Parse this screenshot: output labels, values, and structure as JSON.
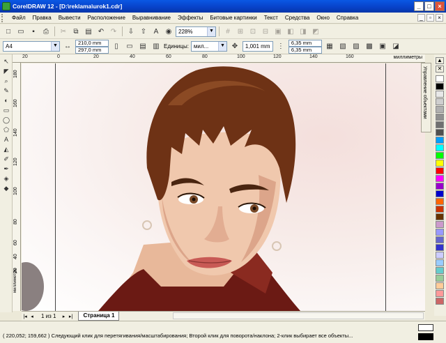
{
  "window": {
    "title": "CorelDRAW 12 - [D:\\reklama\\urok1.cdr]"
  },
  "menu": [
    {
      "label": "Файл"
    },
    {
      "label": "Правка"
    },
    {
      "label": "Вывести"
    },
    {
      "label": "Расположение"
    },
    {
      "label": "Выравнивание"
    },
    {
      "label": "Эффекты"
    },
    {
      "label": "Битовые картинки"
    },
    {
      "label": "Текст"
    },
    {
      "label": "Средства"
    },
    {
      "label": "Окно"
    },
    {
      "label": "Справка"
    }
  ],
  "toolbar": {
    "zoom": "228%"
  },
  "property_bar": {
    "paper": "A4",
    "width": "210,0 mm",
    "height": "297,0 mm",
    "units_label": "Единицы:",
    "units_value": "мил...",
    "nudge": "1,001 mm",
    "dup_x": "6,35 mm",
    "dup_y": "6,35 mm"
  },
  "ruler": {
    "h_ticks": [
      "20",
      "0",
      "20",
      "40",
      "60",
      "80",
      "100",
      "120",
      "140",
      "160"
    ],
    "h_unit": "миллиметры",
    "v_ticks": [
      "180",
      "160",
      "140",
      "120",
      "100",
      "80",
      "60",
      "40",
      "20"
    ],
    "v_unit": "миллиметры"
  },
  "docker": {
    "title": "Управление объектами"
  },
  "pages": {
    "counter": "1 из 1",
    "tab": "Страница 1"
  },
  "status": {
    "text": "( 220,052; 159,662 )  Следующий клик для перетягивания/масштабирования; Второй клик для поворота/наклона; 2-клик выбирает все объекты..."
  },
  "palette": [
    "#ffffff",
    "#000000",
    "#e8e8e8",
    "#cfcfcf",
    "#b0b0b0",
    "#909090",
    "#707070",
    "#505050",
    "#00a0ff",
    "#00ffff",
    "#00ff00",
    "#ffff00",
    "#ff0000",
    "#ff00ff",
    "#9900cc",
    "#0000cc",
    "#ff6600",
    "#cc3300",
    "#663300",
    "#cc99cc",
    "#9999ff",
    "#6666cc",
    "#3333cc",
    "#ccccff",
    "#99ccff",
    "#66cccc",
    "#99cc99",
    "#ffcc99",
    "#ff9999",
    "#cc6666"
  ]
}
